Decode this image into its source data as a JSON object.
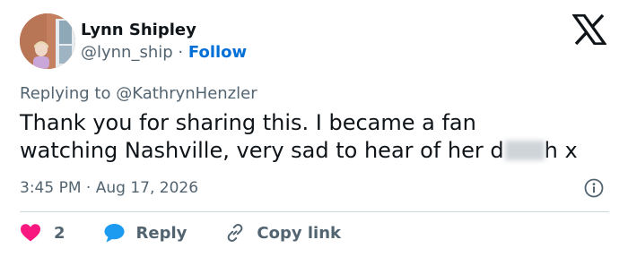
{
  "author": {
    "name": "Lynn Shipley",
    "handle": "@lynn_ship",
    "separator": "·",
    "follow_label": "Follow"
  },
  "reply_context": {
    "prefix": "Replying to",
    "mention": "@KathrynHenzler"
  },
  "tweet": {
    "line1": "Thank you for sharing this. I became a fan",
    "line2_before": "watching Nashville, very sad to hear of her d",
    "line2_after": "h x"
  },
  "meta": {
    "time": "3:45 PM",
    "separator": "·",
    "date": "Aug 17, 2026"
  },
  "actions": {
    "like_count": "2",
    "reply_label": "Reply",
    "copy_link_label": "Copy link"
  },
  "icons": {
    "logo": "x-logo",
    "info": "info-icon",
    "heart": "heart-icon",
    "reply": "speech-bubble-icon",
    "link": "link-icon"
  },
  "colors": {
    "heart": "#f91880",
    "reply_bubble": "#1d9bf0",
    "follow": "#006fd6",
    "secondary_text": "#536471"
  }
}
